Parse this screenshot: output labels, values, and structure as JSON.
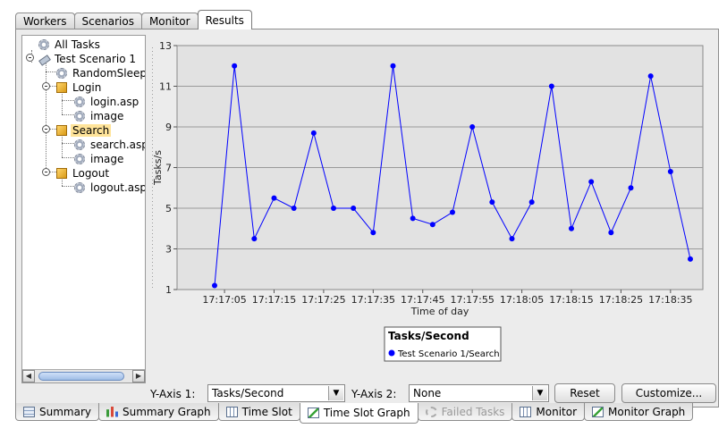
{
  "top_tabs": [
    "Workers",
    "Scenarios",
    "Monitor",
    "Results"
  ],
  "active_top_tab": 3,
  "tree": {
    "items": [
      {
        "label": "All Tasks"
      },
      {
        "label": "Test Scenario 1"
      },
      {
        "label": "RandomSleep"
      },
      {
        "label": "Login"
      },
      {
        "label": "login.asp"
      },
      {
        "label": "image"
      },
      {
        "label": "Search"
      },
      {
        "label": "search.asp"
      },
      {
        "label": "image"
      },
      {
        "label": "Logout"
      },
      {
        "label": "logout.asp"
      }
    ]
  },
  "chart_data": {
    "type": "line",
    "title": "",
    "xlabel": "Time of day",
    "ylabel": "Tasks/s",
    "ylim": [
      1,
      13
    ],
    "yticks": [
      1,
      3,
      5,
      7,
      9,
      11,
      13
    ],
    "xtick_labels": [
      "17:17:05",
      "17:17:15",
      "17:17:25",
      "17:17:35",
      "17:17:45",
      "17:17:55",
      "17:18:05",
      "17:18:15",
      "17:18:25",
      "17:18:35"
    ],
    "legend_title": "Tasks/Second",
    "series": [
      {
        "name": "Test Scenario 1/Search",
        "color": "#0000ff",
        "values": [
          1.2,
          12.0,
          3.5,
          5.5,
          5.0,
          8.7,
          5.0,
          5.0,
          3.8,
          12.0,
          4.5,
          4.2,
          4.8,
          9.0,
          5.3,
          3.5,
          5.3,
          11.0,
          4.0,
          6.3,
          3.8,
          6.0,
          11.5,
          6.8,
          2.5
        ]
      }
    ],
    "grid": true,
    "legend_position": "bottom-center"
  },
  "controls": {
    "y_axis_1_label": "Y-Axis 1:",
    "y_axis_1_value": "Tasks/Second",
    "y_axis_2_label": "Y-Axis 2:",
    "y_axis_2_value": "None",
    "reset_label": "Reset",
    "customize_label": "Customize..."
  },
  "bottom_tabs": [
    {
      "label": "Summary",
      "icon": "summary-icon"
    },
    {
      "label": "Summary Graph",
      "icon": "bar-chart-icon"
    },
    {
      "label": "Time Slot",
      "icon": "grid-icon"
    },
    {
      "label": "Time Slot Graph",
      "icon": "line-graph-icon"
    },
    {
      "label": "Failed Tasks",
      "icon": "gear-icon",
      "disabled": true
    },
    {
      "label": "Monitor",
      "icon": "grid-icon"
    },
    {
      "label": "Monitor Graph",
      "icon": "line-graph-icon"
    }
  ],
  "active_bottom_tab": 3
}
